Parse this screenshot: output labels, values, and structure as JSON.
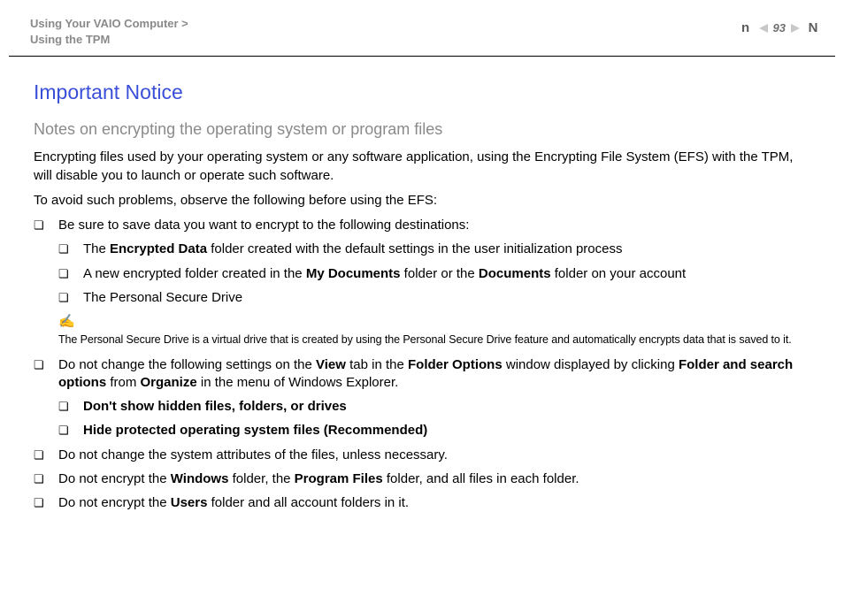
{
  "header": {
    "breadcrumb_line1": "Using Your VAIO Computer >",
    "breadcrumb_line2": "Using the TPM",
    "page_number": "93",
    "letter_n": "n",
    "letter_N": "N"
  },
  "body": {
    "title": "Important Notice",
    "subtitle": "Notes on encrypting the operating system or program files",
    "p1": "Encrypting files used by your operating system or any software application, using the Encrypting File System (EFS) with the TPM, will disable you to launch or operate such software.",
    "p2": "To avoid such problems, observe the following before using the EFS:",
    "b1": "Be sure to save data you want to encrypt to the following destinations:",
    "b1a_pre": "The ",
    "b1a_b": "Encrypted Data",
    "b1a_post": " folder created with the default settings in the user initialization process",
    "b1b_pre": "A new encrypted folder created in the ",
    "b1b_b1": "My Documents",
    "b1b_mid": " folder or the ",
    "b1b_b2": "Documents",
    "b1b_post": " folder on your account",
    "b1c": "The Personal Secure Drive",
    "note1": "The Personal Secure Drive is a virtual drive that is created by using the Personal Secure Drive feature and automatically encrypts data that is saved to it.",
    "b2_pre": "Do not change the following settings on the ",
    "b2_b1": "View",
    "b2_m1": " tab in the ",
    "b2_b2": "Folder Options",
    "b2_m2": " window displayed by clicking ",
    "b2_b3": "Folder and search options",
    "b2_m3": " from ",
    "b2_b4": "Organize",
    "b2_post": " in the menu of Windows Explorer.",
    "b2a": "Don't show hidden files, folders, or drives",
    "b2b": "Hide protected operating system files (Recommended)",
    "b3": "Do not change the system attributes of the files, unless necessary.",
    "b4_pre": "Do not encrypt the ",
    "b4_b1": "Windows",
    "b4_m1": " folder, the ",
    "b4_b2": "Program Files",
    "b4_post": " folder, and all files in each folder.",
    "b5_pre": "Do not encrypt the ",
    "b5_b1": "Users",
    "b5_post": " folder and all account folders in it."
  }
}
